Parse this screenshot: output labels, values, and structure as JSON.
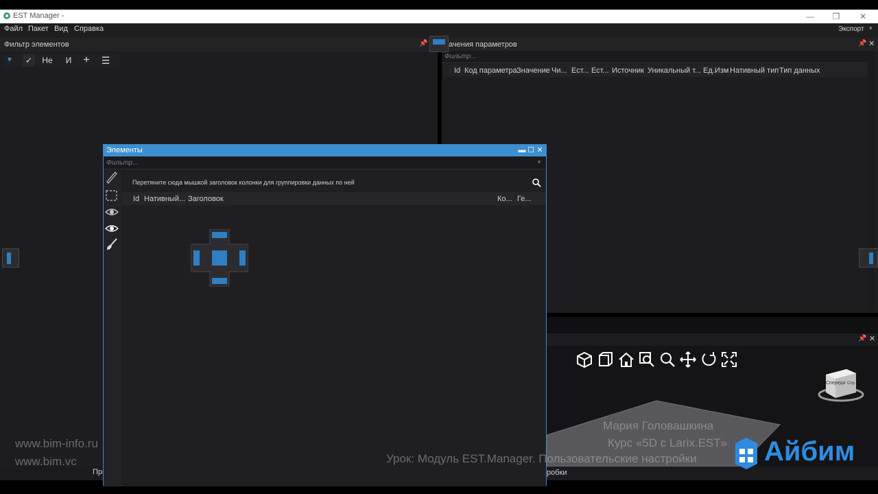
{
  "window": {
    "title": "EST Manager -",
    "controls": {
      "minimize": "—",
      "restore": "❐",
      "close": "✕"
    }
  },
  "menu": {
    "items": [
      "Файл",
      "Пакет",
      "Вид",
      "Справка"
    ],
    "export_label": "Экспорт"
  },
  "filter_panel": {
    "title": "Фильтр элементов",
    "toolbar": {
      "not_label": "Не",
      "and_label": "И",
      "add_label": "+"
    }
  },
  "params_panel": {
    "title": "начения параметров",
    "filter_placeholder": "Фильтр...",
    "columns": [
      "Id",
      "Код параметра",
      "Значение",
      "Чи...",
      "Ест...",
      "Ест...",
      "Источник",
      "Уникальный т...",
      "Ед.Изм",
      "Нативный тип",
      "Тип данных"
    ]
  },
  "elements_window": {
    "title": "Элементы",
    "filter_placeholder": "Фильтр...",
    "group_hint": "Перетяните сюда мышкой заголовок колонки для группировки данных по ней",
    "columns": [
      "Id",
      "Нативный...",
      "Заголовок",
      "Ко...",
      "Ге..."
    ]
  },
  "viewer": {
    "cube_label": "Спереди",
    "cube_label_side": "Спр"
  },
  "bottom_labels": {
    "left_tab": "При",
    "right_tab": "робки"
  },
  "overlay": {
    "site1": "www.bim-info.ru",
    "site2": "www.bim.vc",
    "author": "Мария Головашкина",
    "course": "Курс «5D с Larix.EST»",
    "lesson": "Урок: Модуль EST.Manager. Пользовательские настройки",
    "brand": "Айбим"
  },
  "colors": {
    "accent": "#3d8fd0",
    "panel_bg": "#1d1d1f",
    "brand": "#2f8be0"
  }
}
